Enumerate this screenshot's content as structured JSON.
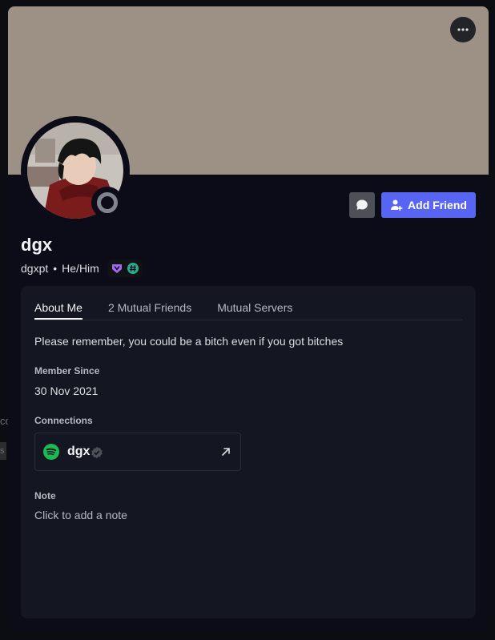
{
  "edge": {
    "fragment_1": "co",
    "fragment_2": "s"
  },
  "profile": {
    "display_name": "dgx",
    "username": "dgxpt",
    "separator": "•",
    "pronouns": "He/Him"
  },
  "colors": {
    "banner": "#9d9185",
    "accent": "#5865f2",
    "status_offline": "#80848e",
    "spotify": "#1db954",
    "nitro_badge": "#a46cf6",
    "hypesquad_badge": "#27ae8f"
  },
  "actions": {
    "add_friend_label": "Add Friend"
  },
  "icons": {
    "more": "ellipsis-icon",
    "message": "chat-bubble-icon",
    "add_friend": "add-user-icon",
    "badge_1": "nitro-badge-icon",
    "badge_2": "hashtag-badge-icon",
    "connection": "spotify-icon",
    "verified": "verified-check-icon",
    "external": "external-link-icon"
  },
  "tabs": [
    {
      "label": "About Me",
      "active": true
    },
    {
      "label": "2 Mutual Friends",
      "active": false
    },
    {
      "label": "Mutual Servers",
      "active": false
    }
  ],
  "about": {
    "bio": "Please remember, you could be a bitch even if you got bitches",
    "member_since_label": "Member Since",
    "member_since_value": "30 Nov 2021",
    "connections_label": "Connections",
    "connection": {
      "service": "Spotify",
      "name": "dgx"
    },
    "note_label": "Note",
    "note_placeholder": "Click to add a note"
  }
}
